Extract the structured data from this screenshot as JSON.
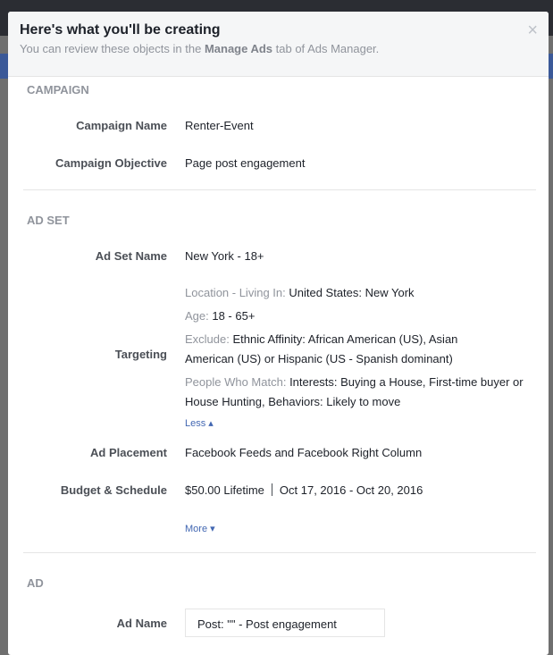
{
  "modal": {
    "title": "Here's what you'll be creating",
    "subtitle_pre": "You can review these objects in the ",
    "subtitle_bold": "Manage Ads",
    "subtitle_post": " tab of Ads Manager.",
    "close_icon": "×"
  },
  "campaign": {
    "heading": "CAMPAIGN",
    "name_label": "Campaign Name",
    "name_value": "Renter-Event",
    "objective_label": "Campaign Objective",
    "objective_value": "Page post engagement"
  },
  "adset": {
    "heading": "AD SET",
    "name_label": "Ad Set Name",
    "name_value": "New York - 18+",
    "targeting_label": "Targeting",
    "targeting": {
      "location_key": "Location - Living In: ",
      "location_val": "United States: New York",
      "age_key": "Age: ",
      "age_val": "18 - 65+",
      "exclude_key": "Exclude: ",
      "exclude_val": "Ethnic Affinity: African American (US), Asian American (US) or Hispanic (US - Spanish dominant)",
      "match_key": "People Who Match: ",
      "match_val": "Interests: Buying a House, First-time buyer or House Hunting, Behaviors: Likely to move",
      "less_link": "Less ▴"
    },
    "placement_label": "Ad Placement",
    "placement_value": "Facebook Feeds and Facebook Right Column",
    "budget_label": "Budget & Schedule",
    "budget_value": "$50.00 Lifetime",
    "schedule_value": "Oct 17, 2016 - Oct 20, 2016",
    "more_link": "More ▾"
  },
  "ad": {
    "heading": "AD",
    "name_label": "Ad Name",
    "name_value": "Post: \"\" - Post engagement"
  }
}
